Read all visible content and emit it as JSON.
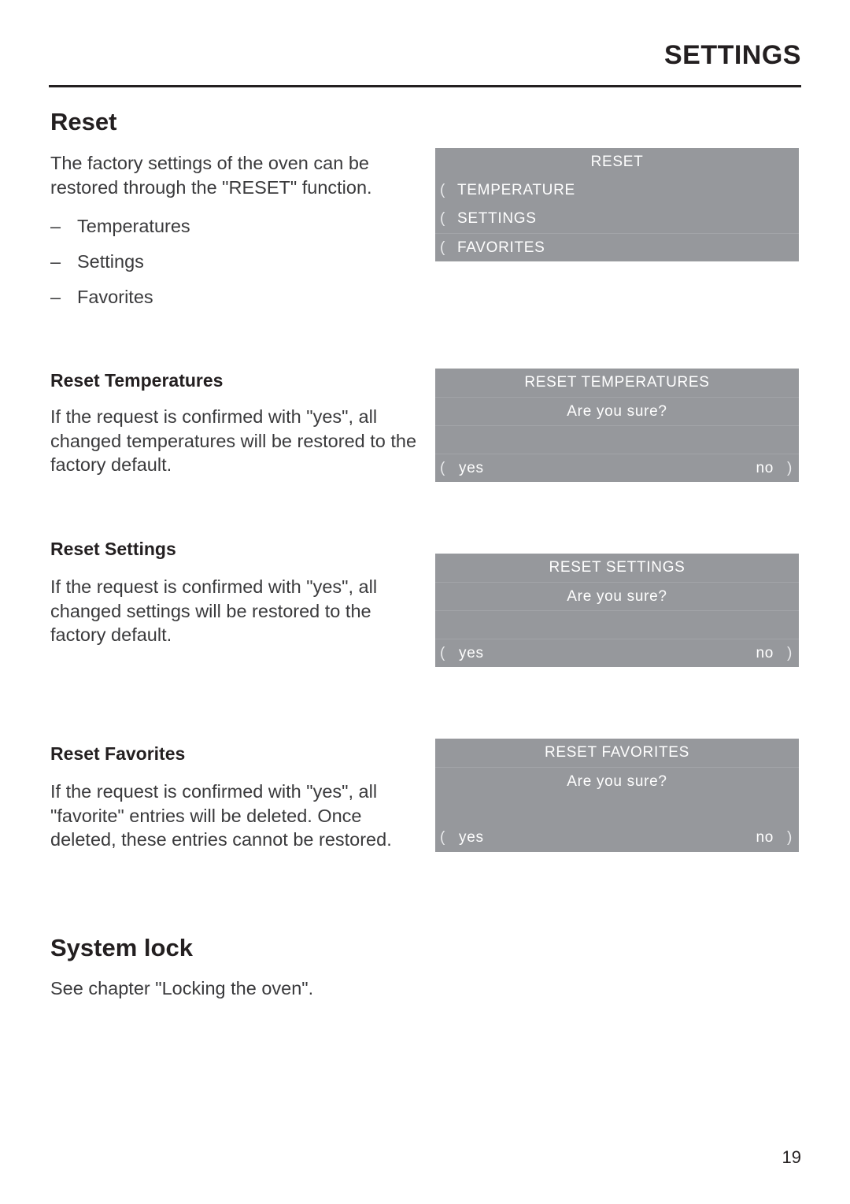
{
  "header": {
    "title": "SETTINGS"
  },
  "sections": {
    "reset": {
      "heading": "Reset",
      "intro": "The factory settings of the oven can be restored through the \"RESET\" function.",
      "dash": "–",
      "list": [
        "Temperatures",
        "Settings",
        "Favorites"
      ]
    },
    "reset_temperatures": {
      "heading": "Reset Temperatures",
      "body": "If the request is confirmed with \"yes\", all changed temperatures will be restored to the factory default."
    },
    "reset_settings": {
      "heading": "Reset Settings",
      "body": "If the request is confirmed with \"yes\", all changed settings will be restored to the factory default."
    },
    "reset_favorites": {
      "heading": "Reset Favorites",
      "body": "If the request is confirmed with \"yes\", all \"favorite\" entries will be deleted. Once deleted, these entries cannot be restored."
    },
    "system_lock": {
      "heading": "System lock",
      "body": "See chapter \"Locking the oven\"."
    }
  },
  "displays": {
    "reset_menu": {
      "title": "RESET",
      "marker": "(",
      "items": [
        "TEMPERATURE",
        "SETTINGS",
        "FAVORITES"
      ]
    },
    "confirm_temperatures": {
      "title": "RESET TEMPERATURES",
      "prompt": "Are you sure?",
      "yes_marker": "(",
      "yes_label": "yes",
      "no_label": "no",
      "no_marker": ")"
    },
    "confirm_settings": {
      "title": "RESET SETTINGS",
      "prompt": "Are you sure?",
      "yes_marker": "(",
      "yes_label": "yes",
      "no_label": "no",
      "no_marker": ")"
    },
    "confirm_favorites": {
      "title": "RESET FAVORITES",
      "prompt": "Are you sure?",
      "yes_marker": "(",
      "yes_label": "yes",
      "no_label": "no",
      "no_marker": ")"
    }
  },
  "footer": {
    "page_number": "19"
  },
  "colors": {
    "display_background": "#96989c",
    "display_text": "#ffffff",
    "ink": "#231f20",
    "body_ink": "#3a3a3c"
  }
}
